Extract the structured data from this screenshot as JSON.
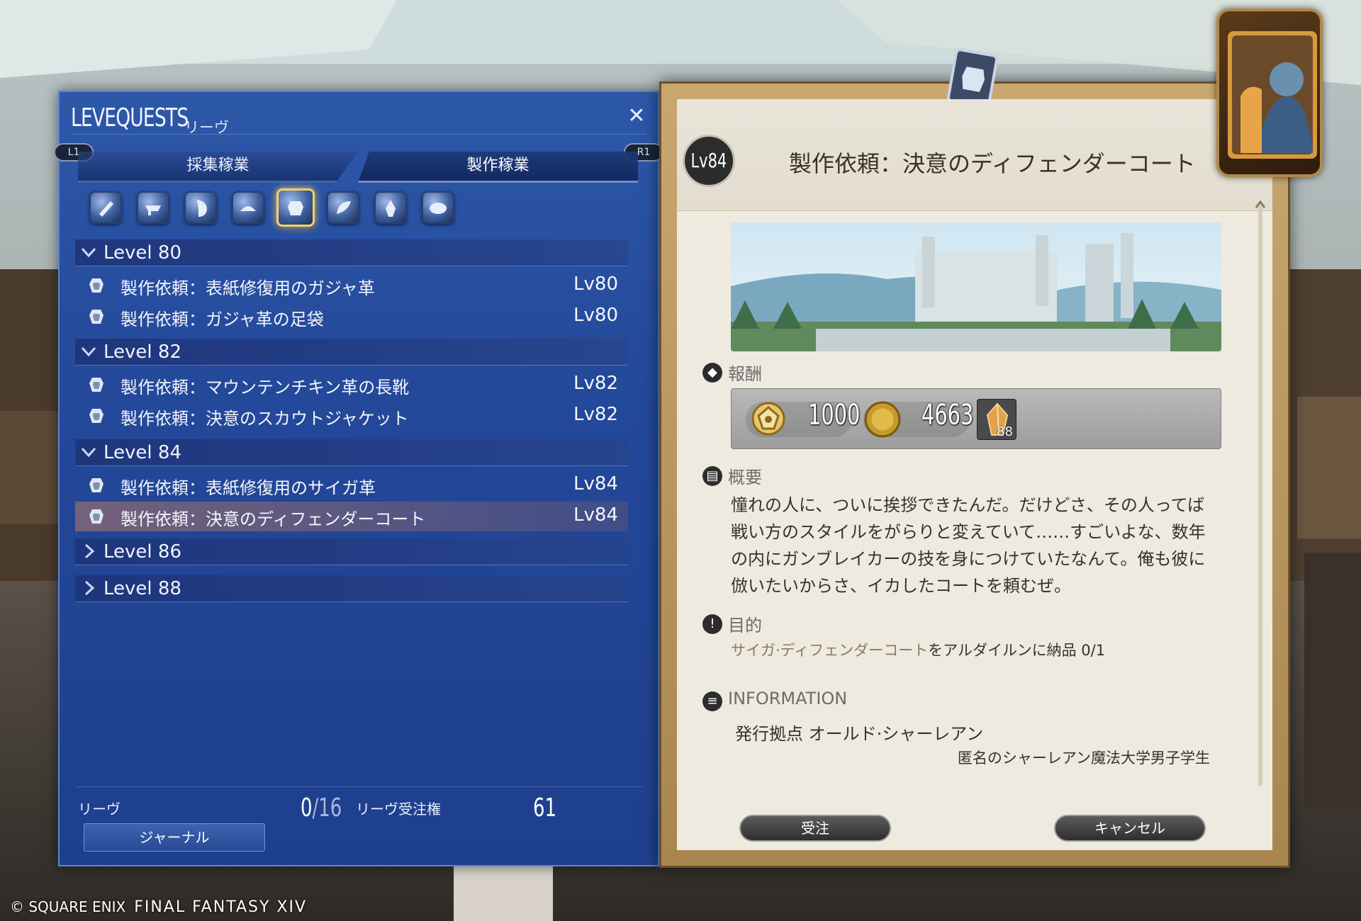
{
  "leve_window": {
    "title": "LEVEQUESTS",
    "subtitle": "リーヴ",
    "close_glyph": "✕",
    "left_shoulder": "L1",
    "right_shoulder": "R1",
    "tabs": [
      {
        "label": "採集稼業",
        "active": false
      },
      {
        "label": "製作稼業",
        "active": true
      }
    ],
    "job_icons": [
      {
        "name": "carpenter-icon",
        "selected": false
      },
      {
        "name": "blacksmith-icon",
        "selected": false
      },
      {
        "name": "armorer-icon",
        "selected": false
      },
      {
        "name": "goldsmith-icon",
        "selected": false
      },
      {
        "name": "leatherworker-icon",
        "selected": true
      },
      {
        "name": "weaver-icon",
        "selected": false
      },
      {
        "name": "alchemist-icon",
        "selected": false
      },
      {
        "name": "culinarian-icon",
        "selected": false
      }
    ],
    "groups": [
      {
        "label": "Level 80",
        "expanded": true,
        "quests": [
          {
            "name": "製作依頼：表紙修復用のガジャ革",
            "level": "Lv80",
            "selected": false
          },
          {
            "name": "製作依頼：ガジャ革の足袋",
            "level": "Lv80",
            "selected": false
          }
        ]
      },
      {
        "label": "Level 82",
        "expanded": true,
        "quests": [
          {
            "name": "製作依頼：マウンテンチキン革の長靴",
            "level": "Lv82",
            "selected": false
          },
          {
            "name": "製作依頼：決意のスカウトジャケット",
            "level": "Lv82",
            "selected": false
          }
        ]
      },
      {
        "label": "Level 84",
        "expanded": true,
        "quests": [
          {
            "name": "製作依頼：表紙修復用のサイガ革",
            "level": "Lv84",
            "selected": false
          },
          {
            "name": "製作依頼：決意のディフェンダーコート",
            "level": "Lv84",
            "selected": true
          }
        ]
      },
      {
        "label": "Level 86",
        "expanded": false,
        "quests": []
      },
      {
        "label": "Level 88",
        "expanded": false,
        "quests": []
      }
    ],
    "footer": {
      "leve_label": "リーヴ",
      "leve_current": "0",
      "leve_max": "16",
      "allowance_label": "リーヴ受注権",
      "allowance_value": "61",
      "journal_button": "ジャーナル"
    }
  },
  "detail_window": {
    "level_badge": "Lv84",
    "title": "製作依頼：決意のディフェンダーコート",
    "reward_heading": "報酬",
    "rewards": {
      "seals": "1000",
      "gil": "4663",
      "crystal_qty": "88"
    },
    "summary_heading": "概要",
    "summary_lines": [
      "憧れの人に、ついに挨拶できたんだ。だけどさ、その人ってば",
      "戦い方のスタイルをがらりと変えていて……すごいよな、数年",
      "の内にガンブレイカーの技を身につけていたなんて。俺も彼に",
      "倣いたいからさ、イカしたコートを頼むぜ。"
    ],
    "objective_heading": "目的",
    "objective": {
      "item": "サイガ·ディフェンダーコート",
      "rest": "をアルダイルンに納品 0/1"
    },
    "info_heading": "INFORMATION",
    "info_location": "発行拠点 オールド·シャーレアン",
    "info_giver": "匿名のシャーレアン魔法大学男子学生",
    "accept_button": "受注",
    "cancel_button": "キャンセル"
  },
  "copyright": {
    "company": "© SQUARE ENIX",
    "game": "FINAL FANTASY XIV"
  },
  "colors": {
    "leve_window_bg": "#24489a",
    "selected_job_border": "#f3d06b",
    "detail_parchment": "#efeae0",
    "detail_frame": "#a8864e"
  }
}
